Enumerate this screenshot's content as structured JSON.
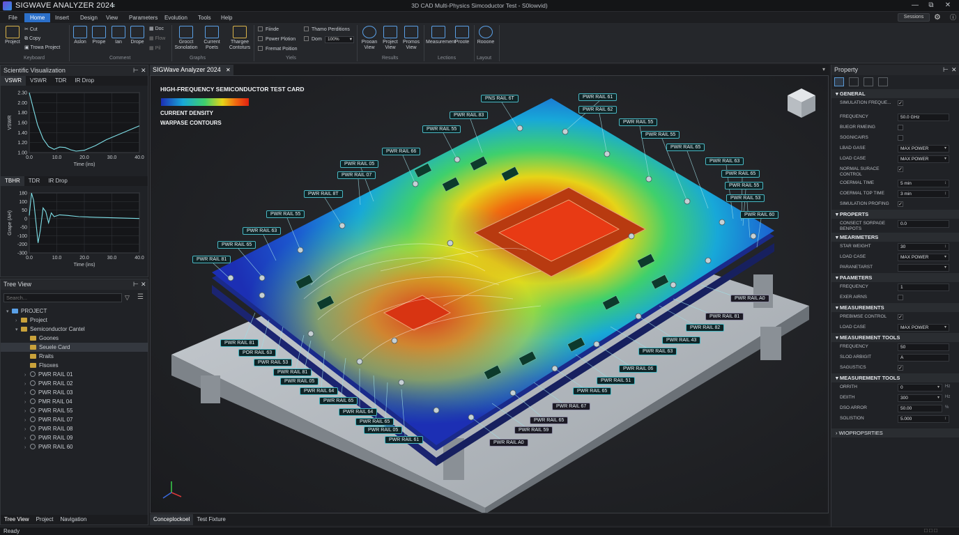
{
  "app": {
    "name": "SIGWAVE ANALYZER 2024",
    "window_title": "3D CAD Multi-Physics Simcoductor Test - S0lowvid)",
    "qa_icon": "≡"
  },
  "menu": [
    "File",
    "Home",
    "Insert",
    "Design",
    "View",
    "Parameters",
    "Evolution",
    "Tools",
    "Help"
  ],
  "sessions_label": "Sessions",
  "ribbon": {
    "keyboard": {
      "label": "Keyboard",
      "project": "Project",
      "cut": "Cut",
      "copy": "Copy",
      "paste": "Trowa Project"
    },
    "comment": {
      "label": "Comment",
      "buttons": [
        "Aslon",
        "Prope",
        "Ian",
        "Drope"
      ],
      "small": [
        "Doc",
        "Flow",
        "Pil"
      ]
    },
    "graphs": {
      "label": "Graphs",
      "buttons": [
        "Grocct Sonolation",
        "Current Poets",
        "Thargee Contoturs"
      ]
    },
    "yiels": {
      "label": "Yiels",
      "checks": [
        "Fiinde",
        "Power Plotion",
        "Fremat Poition",
        "Thamo Perditions"
      ],
      "zoom_label": "Dom",
      "zoom_value": "100%"
    },
    "results": {
      "label": "Results",
      "buttons": [
        "Prooan View",
        "Project View",
        "Promos View"
      ]
    },
    "lections": {
      "label": "Lections",
      "buttons": [
        "Measurement",
        "Proote"
      ]
    },
    "layout": {
      "label": "Layout",
      "buttons": [
        "Rooone"
      ]
    }
  },
  "sci_panel": {
    "title": "Scientific Visualization",
    "tabs1": [
      "VSWR",
      "VSWR",
      "TDR",
      "IR Drop"
    ],
    "plot1": {
      "ylabel": "VSWR",
      "yticks": [
        "2.30",
        "2.00",
        "1.80",
        "1.60",
        "1.40",
        "1.20",
        "1.00"
      ],
      "xticks": [
        "0.0",
        "10.0",
        "20.0",
        "30.0",
        "40.0"
      ],
      "xlabel": "Time (ins)"
    },
    "tabs2": [
      "TBHR",
      "TDR",
      "IR Drop"
    ],
    "plot2": {
      "ylabel": "Grape (AH)",
      "yticks": [
        "180",
        "100",
        "50",
        "0",
        "-50",
        "-100",
        "-200",
        "-300"
      ],
      "xticks": [
        "0.0",
        "10.0",
        "20.0",
        "30.0",
        "40.0"
      ],
      "xlabel": "Time (ins)"
    }
  },
  "chart_data": [
    {
      "type": "line",
      "title": "",
      "xlabel": "Time (ins)",
      "ylabel": "VSWR",
      "xlim": [
        0,
        40
      ],
      "ylim": [
        1.0,
        2.3
      ],
      "x": [
        0,
        1.5,
        3,
        5,
        7,
        9,
        11,
        13,
        15,
        17,
        20,
        24,
        28,
        32,
        36,
        40
      ],
      "y": [
        2.3,
        1.95,
        1.6,
        1.3,
        1.13,
        1.07,
        1.12,
        1.11,
        1.06,
        1.03,
        1.05,
        1.15,
        1.28,
        1.38,
        1.48,
        1.58
      ]
    },
    {
      "type": "line",
      "title": "",
      "xlabel": "Time (ins)",
      "ylabel": "Grape (AH)",
      "xlim": [
        0,
        40
      ],
      "ylim": [
        -300,
        180
      ],
      "x": [
        0,
        0.8,
        1.6,
        2.4,
        3.2,
        4,
        5,
        6,
        7,
        8,
        9,
        11,
        14,
        18,
        24,
        32,
        40
      ],
      "y": [
        0,
        180,
        120,
        -50,
        -220,
        -120,
        60,
        30,
        -60,
        20,
        -10,
        5,
        0,
        -10,
        -15,
        -20,
        -25
      ]
    }
  ],
  "tree": {
    "title": "Tree View",
    "search_placeholder": "Search...",
    "nodes": [
      {
        "label": "PROJECT",
        "level": 0,
        "kind": "root"
      },
      {
        "label": "Project",
        "level": 1,
        "kind": "folder"
      },
      {
        "label": "Semiconductor Cantel",
        "level": 1,
        "kind": "folder"
      },
      {
        "label": "Goones",
        "level": 2,
        "kind": "folder"
      },
      {
        "label": "Seuele Card",
        "level": 2,
        "kind": "folder",
        "selected": true
      },
      {
        "label": "Rraits",
        "level": 2,
        "kind": "folder"
      },
      {
        "label": "Flsoxes",
        "level": 2,
        "kind": "folder"
      },
      {
        "label": "PWR RAIL 01",
        "level": 2,
        "kind": "item"
      },
      {
        "label": "PWR RAIL 02",
        "level": 2,
        "kind": "item"
      },
      {
        "label": "PWR RAIL 03",
        "level": 2,
        "kind": "item"
      },
      {
        "label": "PMR RAIL 04",
        "level": 2,
        "kind": "item"
      },
      {
        "label": "PWR RAIL 55",
        "level": 2,
        "kind": "item"
      },
      {
        "label": "PWR RAIL 07",
        "level": 2,
        "kind": "item"
      },
      {
        "label": "PWR RAIL 08",
        "level": 2,
        "kind": "item"
      },
      {
        "label": "PWR RAIL 09",
        "level": 2,
        "kind": "item"
      },
      {
        "label": "PWR RAIL 60",
        "level": 2,
        "kind": "item"
      }
    ],
    "bottom_tabs": [
      "Tree View",
      "Project",
      "Navigation"
    ]
  },
  "viewport": {
    "doc_tab": "SIGWave Analyzer 2024",
    "overlay_title": "HIGH-FREQUENCY SEMICONDUCTOR TEST CARD",
    "legend1": "CURRENT DENSITY",
    "legend2": "WARPASE CONTOURS",
    "bottom_tabs": [
      "Conceplockoel",
      "Test Fixture"
    ],
    "callouts": [
      "PNS RAIL 6T",
      "PWR RAIL 61",
      "PWR RAIL 83",
      "PWR RAIL 62",
      "PWR RAIL 55",
      "PWR RAIL 55",
      "PWR RAIL 55",
      "PWR RAIL 66",
      "PWR RAIL 65",
      "PWR RAIL 05",
      "PWR RAIL 63",
      "PWR RAIL 07",
      "PWR RAIL 65",
      "PWR RAIL 8T",
      "PWR RAIL 55",
      "PWR RAIL 55",
      "PWR RAIL 53",
      "PWR RAIL 63",
      "PWR RAIL 60",
      "PWR RAIL 65",
      "PWR RAIL 81",
      "PWR RAIL A0",
      "PWR RAIL 81",
      "PWR RAIL 82",
      "PWR RAIL 43",
      "PWR RAIL 63",
      "PWR RAIL 06",
      "PWR RAIL 51",
      "PWR RAIL 65",
      "PWR RAIL 67",
      "PWR RAIL 65",
      "PWR RAIL 59",
      "PWR RAIL A0",
      "PWR RAIL 81",
      "POR RAIL 63",
      "PWR RAIL 53",
      "PWR RAIL 81",
      "PWR RAIL 05",
      "PWR RAIL 64",
      "PWR RAIL 65",
      "PWR RAIL 64",
      "PWR RAIL 65",
      "PWR RAIL 05",
      "PWR RAIL 61"
    ]
  },
  "property": {
    "title": "Property",
    "sections": [
      {
        "title": "GENERAL",
        "rows": [
          {
            "label": "SIMULATION FREQUE...",
            "type": "check",
            "value": "✓"
          },
          {
            "label": "FREQUENCY",
            "type": "text",
            "value": "50.0 GHz"
          },
          {
            "label": "BUEOR RMEING",
            "type": "check",
            "value": ""
          },
          {
            "label": "SOGNICAIRS",
            "type": "check",
            "value": ""
          },
          {
            "label": "LBAD GASE",
            "type": "select",
            "value": "MAX POWER"
          },
          {
            "label": "LOAD CASE",
            "type": "select",
            "value": "MAX POWER"
          },
          {
            "label": "NORMAL SURACE CONTROL",
            "type": "check",
            "value": "✓"
          },
          {
            "label": "COERMAL TIME",
            "type": "spin",
            "value": "5 min"
          },
          {
            "label": "COERMAL TOP TIME",
            "type": "spin",
            "value": "3 min"
          },
          {
            "label": "SIMULATION PROFING",
            "type": "check",
            "value": "✓"
          }
        ]
      },
      {
        "title": "PROPERTS",
        "rows": [
          {
            "label": "CONSECT SORPAGE BENPOTS",
            "type": "text",
            "value": "0.0"
          }
        ]
      },
      {
        "title": "MEARIMETERS",
        "rows": [
          {
            "label": "STAR WEIGHT",
            "type": "spin",
            "value": "30"
          },
          {
            "label": "LOAD CASE",
            "type": "select",
            "value": "MAX POWER"
          },
          {
            "label": "PARANETARST",
            "type": "select",
            "value": ""
          }
        ]
      },
      {
        "title": "PAAMETERS",
        "rows": [
          {
            "label": "FREQUENCY",
            "type": "text",
            "value": "1"
          },
          {
            "label": "EXER AIRNS",
            "type": "check",
            "value": ""
          }
        ]
      },
      {
        "title": "MEASUREMENTS",
        "rows": [
          {
            "label": "PREBIMSE CONTROL",
            "type": "check",
            "value": "✓"
          },
          {
            "label": "LOAD CASE",
            "type": "select",
            "value": "MAX POWER"
          }
        ]
      },
      {
        "title": "MEASUREMENT TOOLS",
        "rows": [
          {
            "label": "FREQUENCY",
            "type": "text",
            "value": "50"
          },
          {
            "label": "SLOD ARBIGIT",
            "type": "text",
            "value": "A"
          },
          {
            "label": "SAGUSTICS",
            "type": "check",
            "value": "✓"
          }
        ]
      },
      {
        "title": "MEASUREMENT TOOLS",
        "rows": [
          {
            "label": "ORRITH",
            "type": "select",
            "value": "0",
            "unit": "Hz"
          },
          {
            "label": "DEIITH",
            "type": "select",
            "value": "300",
            "unit": "Hz"
          },
          {
            "label": "DSO ARROR",
            "type": "text",
            "value": "50.00",
            "unit": "%"
          },
          {
            "label": "SOLISTION",
            "type": "spin",
            "value": "5.000"
          }
        ]
      }
    ],
    "footer": "WIOPROPSRTIES"
  },
  "status": {
    "text": "Ready"
  },
  "colors": {
    "accent": "#2b6fc9",
    "callout_border": "#49b8c4"
  }
}
